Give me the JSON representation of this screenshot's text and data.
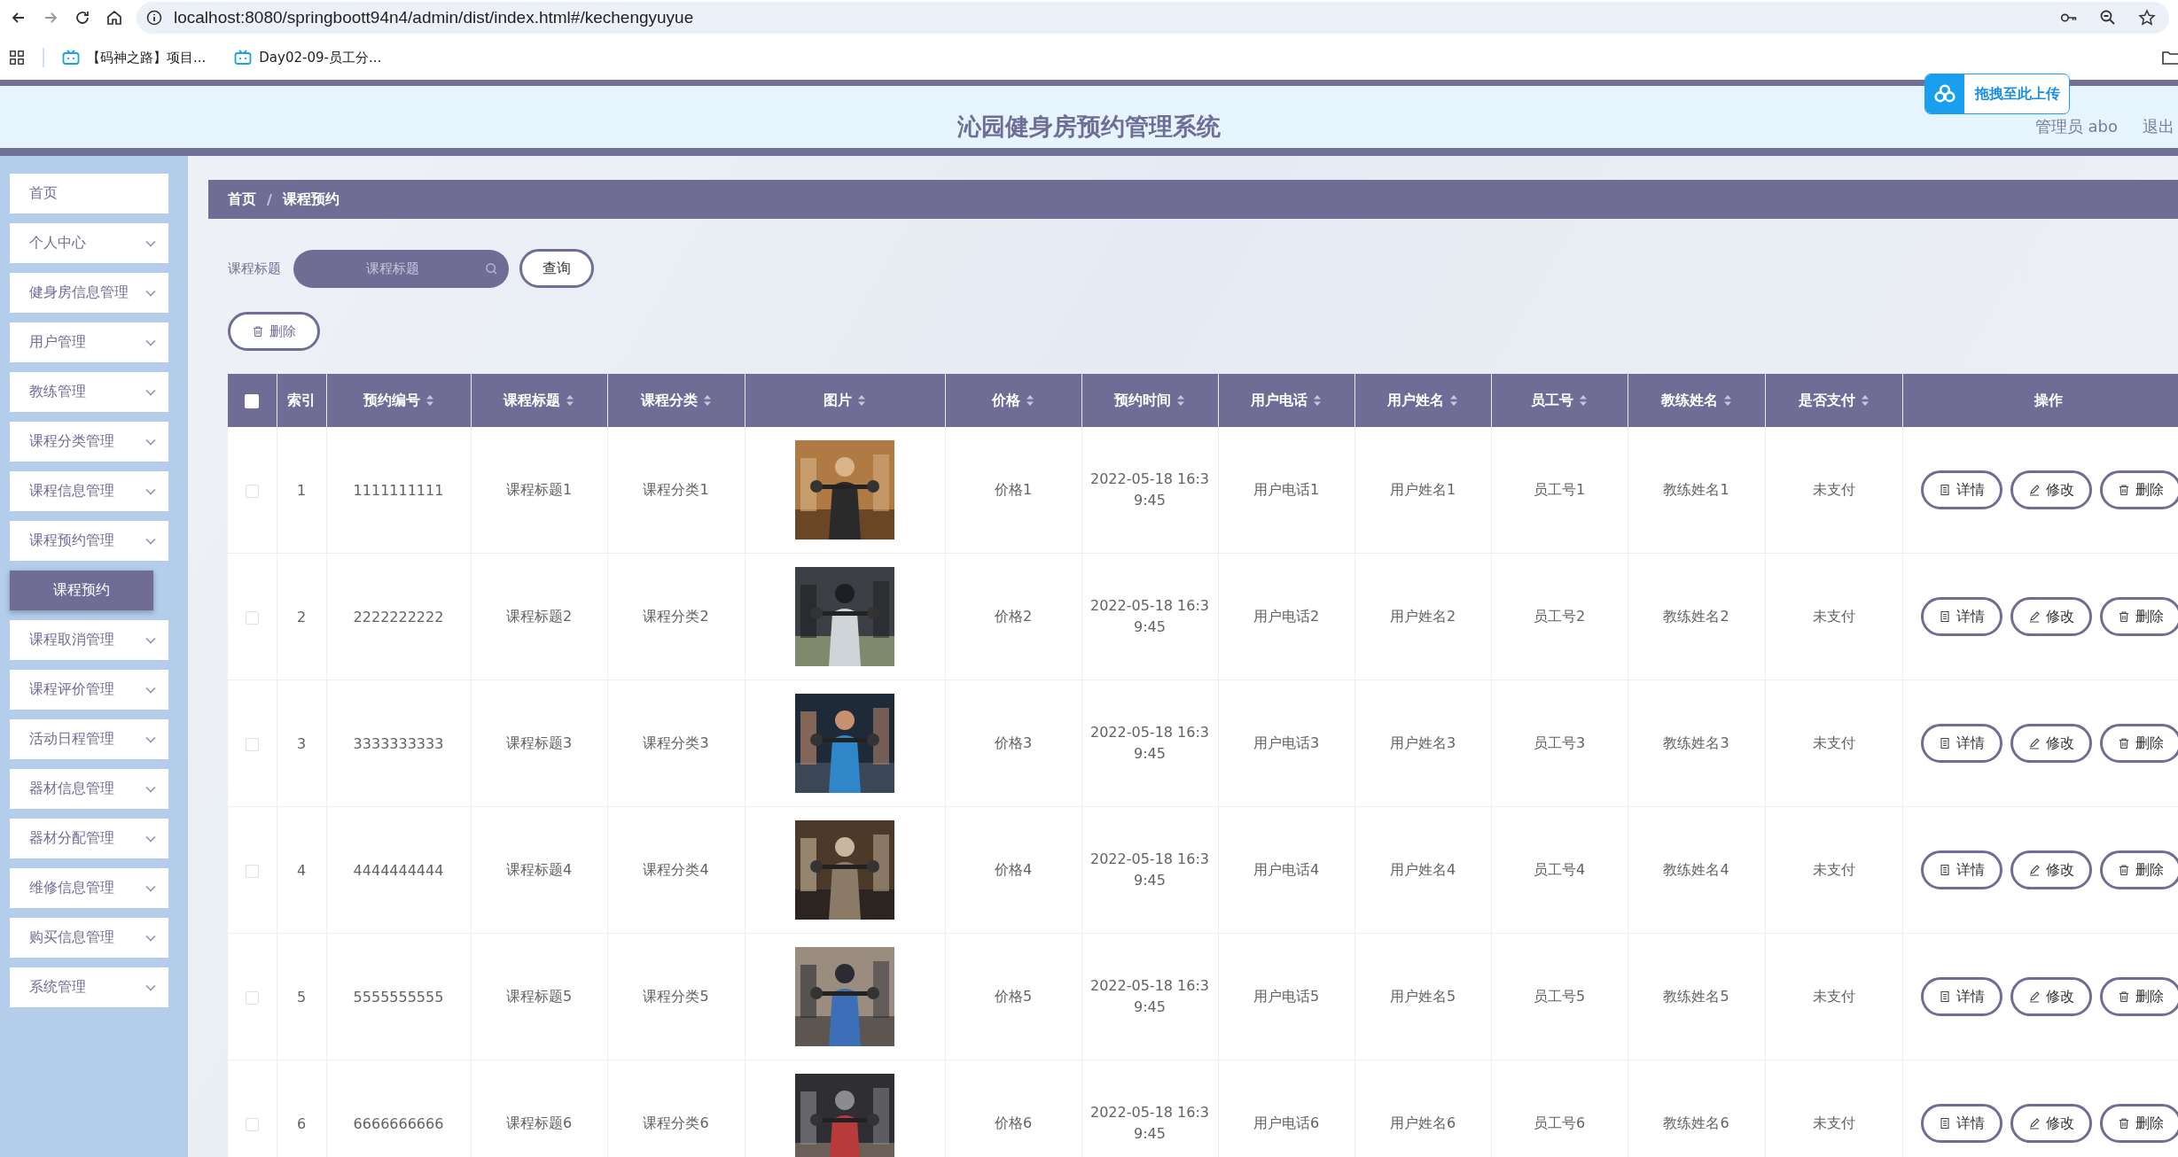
{
  "browser": {
    "url": "localhost:8080/springboott94n4/admin/dist/index.html#/kechengyuyue",
    "bookmarks": [
      "【码神之路】项目...",
      "Day02-09-员工分..."
    ]
  },
  "header": {
    "title": "沁园健身房预约管理系统",
    "user": "管理员 abo",
    "logout": "退出"
  },
  "upload_widget": {
    "label": "拖拽至此上传"
  },
  "sidebar": {
    "items": [
      {
        "label": "首页",
        "kind": "link"
      },
      {
        "label": "个人中心",
        "kind": "menu"
      },
      {
        "label": "健身房信息管理",
        "kind": "menu"
      },
      {
        "label": "用户管理",
        "kind": "menu"
      },
      {
        "label": "教练管理",
        "kind": "menu"
      },
      {
        "label": "课程分类管理",
        "kind": "menu"
      },
      {
        "label": "课程信息管理",
        "kind": "menu"
      },
      {
        "label": "课程预约管理",
        "kind": "menu",
        "children": [
          {
            "label": "课程预约",
            "selected": true
          }
        ]
      },
      {
        "label": "课程取消管理",
        "kind": "menu"
      },
      {
        "label": "课程评价管理",
        "kind": "menu"
      },
      {
        "label": "活动日程管理",
        "kind": "menu"
      },
      {
        "label": "器材信息管理",
        "kind": "menu"
      },
      {
        "label": "器材分配管理",
        "kind": "menu"
      },
      {
        "label": "维修信息管理",
        "kind": "menu"
      },
      {
        "label": "购买信息管理",
        "kind": "menu"
      },
      {
        "label": "系统管理",
        "kind": "menu"
      }
    ]
  },
  "breadcrumb": {
    "items": [
      "首页",
      "课程预约"
    ],
    "separator": "/"
  },
  "search": {
    "label": "课程标题",
    "placeholder": "课程标题",
    "button": "查询"
  },
  "delete_button": "删除",
  "table": {
    "header_checked": false,
    "columns": [
      {
        "label": "索引",
        "sortable": false
      },
      {
        "label": "预约编号",
        "sortable": true
      },
      {
        "label": "课程标题",
        "sortable": true
      },
      {
        "label": "课程分类",
        "sortable": true
      },
      {
        "label": "图片",
        "sortable": true
      },
      {
        "label": "价格",
        "sortable": true
      },
      {
        "label": "预约时间",
        "sortable": true
      },
      {
        "label": "用户电话",
        "sortable": true
      },
      {
        "label": "用户姓名",
        "sortable": true
      },
      {
        "label": "员工号",
        "sortable": true
      },
      {
        "label": "教练姓名",
        "sortable": true
      },
      {
        "label": "是否支付",
        "sortable": true
      },
      {
        "label": "操作",
        "sortable": false
      }
    ],
    "rows": [
      {
        "checked": false,
        "index": "1",
        "number": "1111111111",
        "title": "课程标题1",
        "category": "课程分类1",
        "price": "价格1",
        "time": "2022-05-18 16:39:45",
        "phone": "用户电话1",
        "user": "用户姓名1",
        "staff": "员工号1",
        "coach": "教练姓名1",
        "paid": "未支付",
        "actions": [
          "详情",
          "修改",
          "删除"
        ]
      },
      {
        "checked": false,
        "index": "2",
        "number": "2222222222",
        "title": "课程标题2",
        "category": "课程分类2",
        "price": "价格2",
        "time": "2022-05-18 16:39:45",
        "phone": "用户电话2",
        "user": "用户姓名2",
        "staff": "员工号2",
        "coach": "教练姓名2",
        "paid": "未支付",
        "actions": [
          "详情",
          "修改",
          "删除"
        ]
      },
      {
        "checked": false,
        "index": "3",
        "number": "3333333333",
        "title": "课程标题3",
        "category": "课程分类3",
        "price": "价格3",
        "time": "2022-05-18 16:39:45",
        "phone": "用户电话3",
        "user": "用户姓名3",
        "staff": "员工号3",
        "coach": "教练姓名3",
        "paid": "未支付",
        "actions": [
          "详情",
          "修改",
          "删除"
        ]
      },
      {
        "checked": false,
        "index": "4",
        "number": "4444444444",
        "title": "课程标题4",
        "category": "课程分类4",
        "price": "价格4",
        "time": "2022-05-18 16:39:45",
        "phone": "用户电话4",
        "user": "用户姓名4",
        "staff": "员工号4",
        "coach": "教练姓名4",
        "paid": "未支付",
        "actions": [
          "详情",
          "修改",
          "删除"
        ]
      },
      {
        "checked": false,
        "index": "5",
        "number": "5555555555",
        "title": "课程标题5",
        "category": "课程分类5",
        "price": "价格5",
        "time": "2022-05-18 16:39:45",
        "phone": "用户电话5",
        "user": "用户姓名5",
        "staff": "员工号5",
        "coach": "教练姓名5",
        "paid": "未支付",
        "actions": [
          "详情",
          "修改",
          "删除"
        ]
      },
      {
        "checked": false,
        "index": "6",
        "number": "6666666666",
        "title": "课程标题6",
        "category": "课程分类6",
        "price": "价格6",
        "time": "2022-05-18 16:39:45",
        "phone": "用户电话6",
        "user": "用户姓名6",
        "staff": "员工号6",
        "coach": "教练姓名6",
        "paid": "未支付",
        "actions": [
          "详情",
          "修改",
          "删除"
        ]
      }
    ]
  }
}
